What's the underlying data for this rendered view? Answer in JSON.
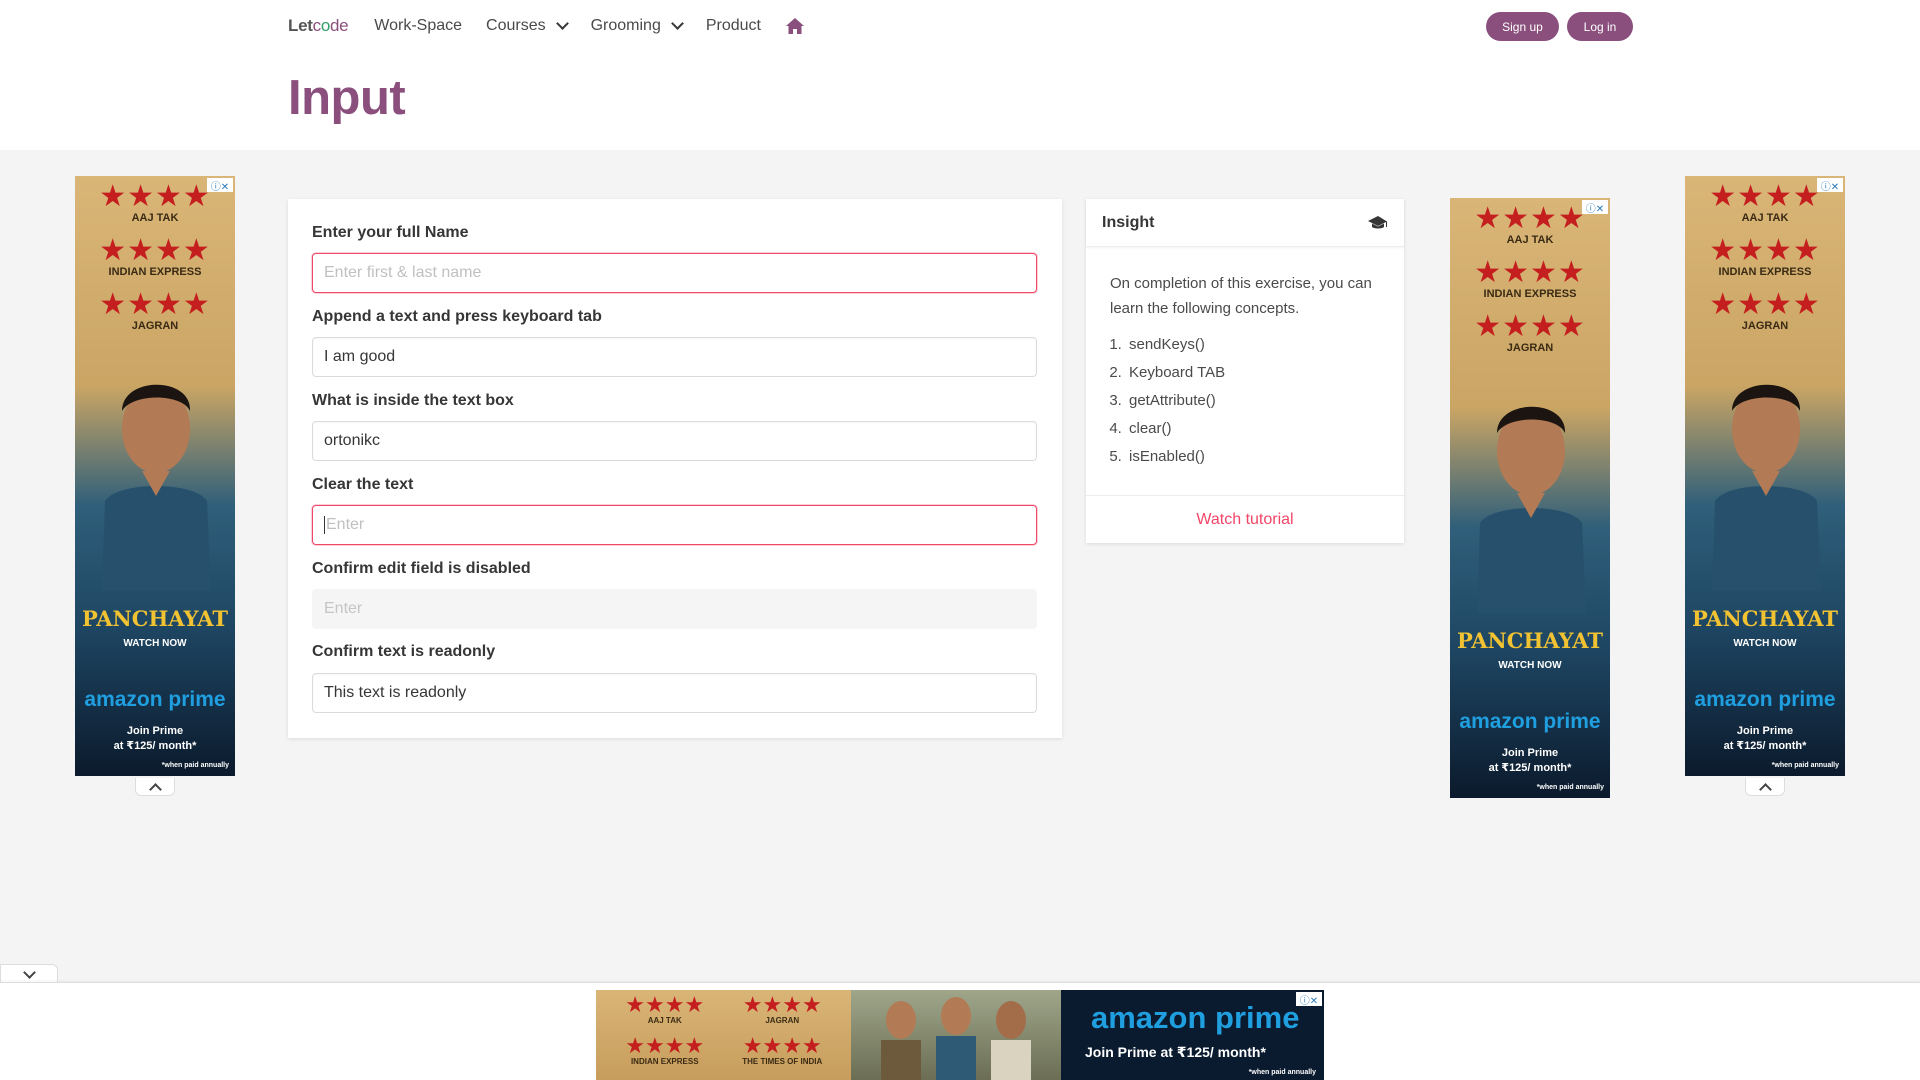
{
  "nav": {
    "logo_a": "Let",
    "logo_b": "c",
    "logo_c": "o",
    "logo_d": "de",
    "items": [
      "Work-Space",
      "Courses",
      "Grooming",
      "Product"
    ],
    "signup": "Sign up",
    "login": "Log in"
  },
  "page": {
    "title": "Input"
  },
  "form": {
    "fields": [
      {
        "label": "Enter your full Name",
        "value": "",
        "placeholder": "Enter first & last name"
      },
      {
        "label": "Append a text and press keyboard tab",
        "value": "I am good",
        "placeholder": ""
      },
      {
        "label": "What is inside the text box",
        "value": "ortonikc",
        "placeholder": ""
      },
      {
        "label": "Clear the text",
        "value": "",
        "placeholder": "Enter"
      },
      {
        "label": "Confirm edit field is disabled",
        "value": "",
        "placeholder": "Enter"
      },
      {
        "label": "Confirm text is readonly",
        "value": "This text is readonly",
        "placeholder": ""
      }
    ]
  },
  "insight": {
    "title": "Insight",
    "intro": "On completion of this exercise, you can learn the following concepts.",
    "concepts": [
      "sendKeys()",
      "Keyboard TAB",
      "getAttribute()",
      "clear()",
      "isEnabled()"
    ],
    "tutorial": "Watch tutorial"
  },
  "ad": {
    "sources": [
      "AAJ TAK",
      "INDIAN EXPRESS",
      "JAGRAN"
    ],
    "stars": "★★★★",
    "show": "PANCHAYAT",
    "watch": "WATCH NOW",
    "brand": "amazon prime",
    "join_line1": "Join Prime",
    "join_line2": "at ₹125/ month*",
    "note": "*when paid annually"
  },
  "bottom_ad": {
    "sources": [
      "AAJ TAK",
      "JAGRAN",
      "INDIAN EXPRESS",
      "THE TIMES OF INDIA"
    ],
    "brand": "amazon prime",
    "join": "Join Prime at ₹125/ month*",
    "note": "*when paid annually"
  },
  "colors": {
    "primary": "#8a4f7d",
    "danger": "#f14668"
  }
}
